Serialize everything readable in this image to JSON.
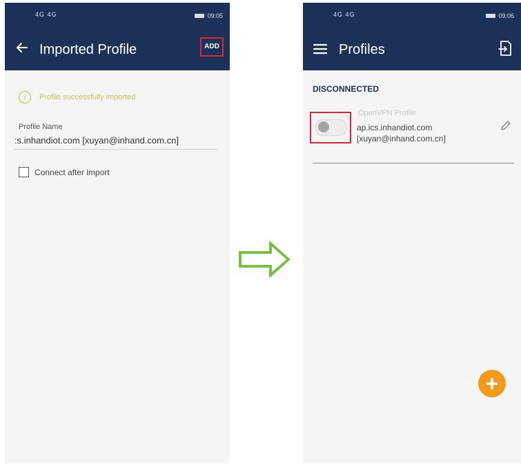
{
  "left_screen": {
    "status": {
      "signal": "4G 4G",
      "time": "09:05"
    },
    "appbar": {
      "title": "Imported Profile",
      "add_label": "ADD"
    },
    "message": "Profile successfully imported",
    "field": {
      "label": "Profile Name",
      "value": ":s.inhandiot.com [xuyan@inhand.com.cn]"
    },
    "checkbox_label": "Connect after import"
  },
  "right_screen": {
    "status": {
      "signal": "4G 4G",
      "time": "09:06"
    },
    "appbar": {
      "title": "Profiles"
    },
    "section_header": "DISCONNECTED",
    "profile": {
      "type": "OpenVPN Profile",
      "host": "ap.ics.inhandiot.com",
      "user": "[xuyan@inhand.com.cn]",
      "enabled": false
    }
  },
  "colors": {
    "appbar": "#1c3158",
    "highlight_border": "#d42a3c",
    "success": "#bcc65a",
    "fab": "#f39a1c",
    "arrow": "#7cc043"
  },
  "icons": [
    "back-arrow-icon",
    "info-icon",
    "menu-icon",
    "import-file-icon",
    "edit-pencil-icon",
    "plus-icon",
    "right-arrow-icon"
  ]
}
